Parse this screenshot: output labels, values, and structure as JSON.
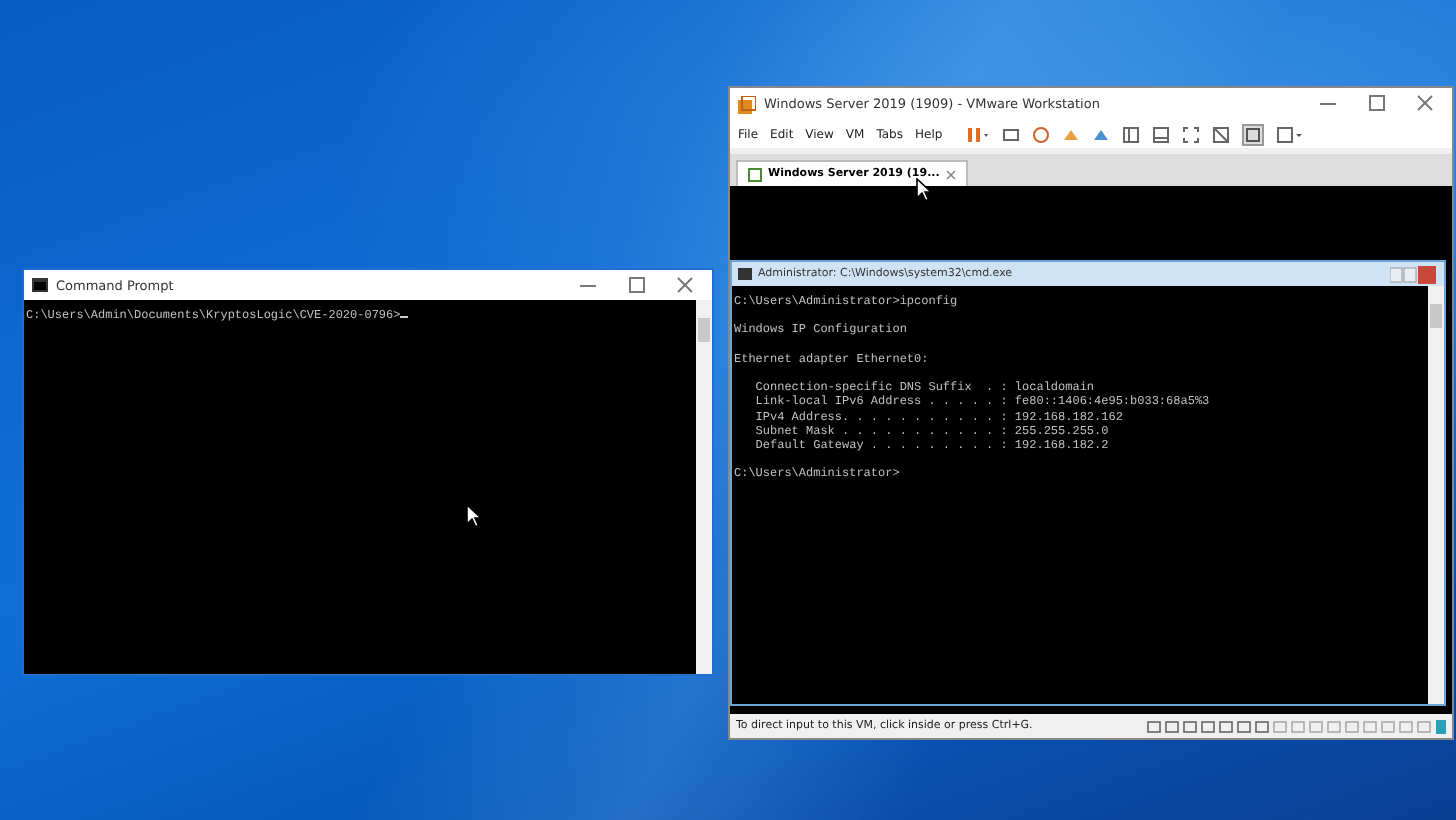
{
  "cmd_window": {
    "title": "Command Prompt",
    "lines": [
      "C:\\Users\\Admin\\Documents\\KryptosLogic\\CVE-2020-0796>"
    ]
  },
  "vmware_window": {
    "title": "Windows Server 2019 (1909) - VMware Workstation",
    "menu": [
      "File",
      "Edit",
      "View",
      "VM",
      "Tabs",
      "Help"
    ],
    "tabs": [
      {
        "label": "Windows Server 2019 (19...",
        "selected": true
      }
    ],
    "guest_cmd": {
      "title": "Administrator: C:\\Windows\\system32\\cmd.exe",
      "blocks": [
        [
          "C:\\Users\\Administrator>ipconfig"
        ],
        [
          "Windows IP Configuration"
        ],
        [
          "Ethernet adapter Ethernet0:"
        ],
        [
          "   Connection-specific DNS Suffix  . : localdomain",
          "   Link-local IPv6 Address . . . . . : fe80::1406:4e95:b033:68a5%3",
          "   IPv4 Address. . . . . . . . . . . : 192.168.182.162",
          "   Subnet Mask . . . . . . . . . . . : 255.255.255.0",
          "   Default Gateway . . . . . . . . . : 192.168.182.2"
        ],
        [
          "C:\\Users\\Administrator>"
        ]
      ]
    },
    "status_bar": "To direct input to this VM, click inside or press Ctrl+G."
  }
}
